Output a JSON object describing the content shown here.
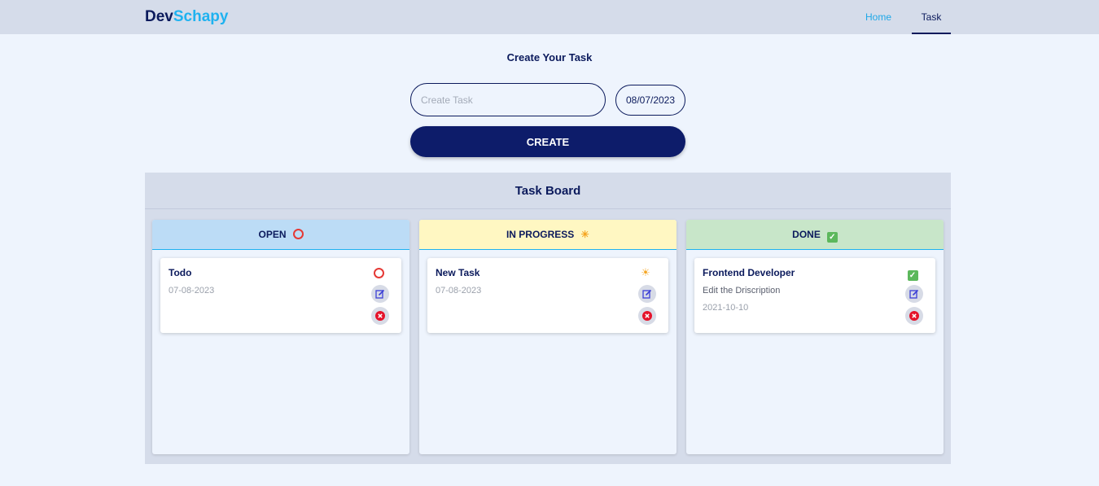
{
  "nav": {
    "brand_part1": "Dev",
    "brand_part2": "Schapy",
    "links": [
      {
        "label": "Home",
        "active": false
      },
      {
        "label": "Task",
        "active": true
      }
    ]
  },
  "create": {
    "title": "Create Your Task",
    "task_placeholder": "Create Task",
    "task_value": "",
    "date_value": "08/07/2023",
    "button_label": "CREATE"
  },
  "board": {
    "title": "Task Board",
    "columns": [
      {
        "label": "OPEN",
        "icon": "red-circle-icon",
        "cards": [
          {
            "title": "Todo",
            "description": "",
            "date": "07-08-2023",
            "status_icon": "red-circle-icon"
          }
        ]
      },
      {
        "label": "IN PROGRESS",
        "icon": "sun-icon",
        "cards": [
          {
            "title": "New Task",
            "description": "",
            "date": "07-08-2023",
            "status_icon": "sun-icon"
          }
        ]
      },
      {
        "label": "DONE",
        "icon": "check-mark-icon",
        "cards": [
          {
            "title": "Frontend Developer",
            "description": "Edit the Driscription",
            "date": "2021-10-10",
            "status_icon": "check-mark-icon"
          }
        ]
      }
    ]
  },
  "colors": {
    "navy": "#0b1a5c",
    "brand_accent": "#1fb2f0",
    "open_header": "#bcdcf6",
    "progress_header": "#fff7c2",
    "done_header": "#c8e6c9",
    "delete_red": "#e5132b",
    "edit_blue": "#3b3fd6"
  }
}
